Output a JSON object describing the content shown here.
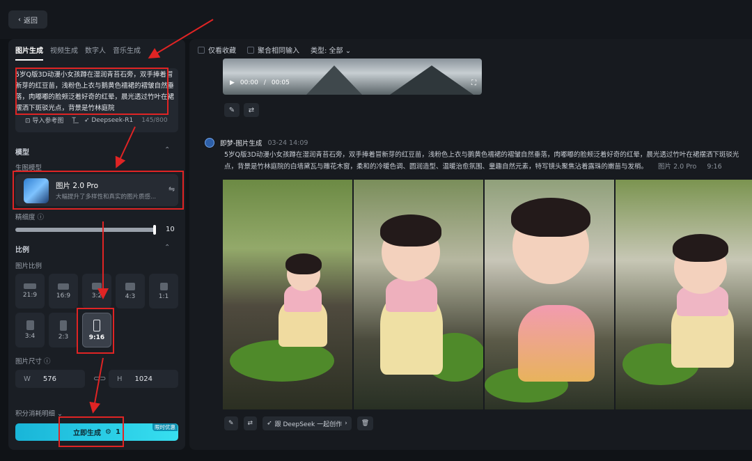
{
  "topbar": {
    "back_label": "返回"
  },
  "left": {
    "tabs": [
      {
        "label": "图片生成",
        "active": true
      },
      {
        "label": "视频生成",
        "active": false
      },
      {
        "label": "数字人",
        "active": false
      },
      {
        "label": "音乐生成",
        "active": false
      }
    ],
    "prompt": {
      "text": "5岁Q版3D动漫小女孩蹲在湿润青苔石旁，双手捧着冒新芽的红豆苗，浅粉色上衣与鹅黄色襦裙的褶皱自然垂落，肉嘟嘟的脸颊泛着好奇的红晕，晨光透过竹叶在裙摆洒下斑驳光点，背景是竹林庭院",
      "ref_image_label": "导入参考图",
      "model_label": "Deepseek-R1",
      "char_count": "145/800"
    },
    "model_section": {
      "title": "模型",
      "sub_label": "生图模型",
      "model_name": "图片 2.0 Pro",
      "model_desc": "大幅提升了多样性和真实的图片质感..."
    },
    "precision": {
      "label": "精细度",
      "value": "10",
      "fraction": 1.0
    },
    "ratio_section": {
      "title": "比例",
      "sub_label": "图片比例",
      "ratios": [
        {
          "label": "21:9",
          "active": false
        },
        {
          "label": "16:9",
          "active": false
        },
        {
          "label": "3:2",
          "active": false
        },
        {
          "label": "4:3",
          "active": false
        },
        {
          "label": "1:1",
          "active": false
        },
        {
          "label": "3:4",
          "active": false
        },
        {
          "label": "2:3",
          "active": false
        },
        {
          "label": "9:16",
          "active": true
        }
      ]
    },
    "size": {
      "label": "图片尺寸",
      "w_key": "W",
      "w_value": "576",
      "h_key": "H",
      "h_value": "1024"
    },
    "credits_label": "积分消耗明细",
    "generate": {
      "label": "立即生成",
      "cost": "1",
      "promo": "限时优惠"
    }
  },
  "main": {
    "filters": {
      "favorites": "仅看收藏",
      "aggregate": "聚合相同输入",
      "type": "类型: 全部"
    },
    "video": {
      "time": "00:00",
      "duration": "00:05"
    },
    "record": {
      "title": "即梦-图片生成",
      "time": "03-24  14:09",
      "prompt": "5岁Q版3D动漫小女孩蹲在湿润青苔石旁，双手捧着冒新芽的红豆苗，浅粉色上衣与鹅黄色襦裙的褶皱自然垂落，肉嘟嘟的脸颊泛着好奇的红晕，晨光透过竹叶在裙摆洒下斑驳光点，背景是竹林庭院的白墙黛瓦与雕花木窗，柔和的冷暖色调、圆润造型、温暖治愈氛围、童趣自然元素，特写镜头聚焦沾着露珠的嫩苗与发梢。",
      "model_tag": "图片 2.0 Pro",
      "ratio_tag": "9:16"
    },
    "actions": {
      "deepseek_label": "跟 DeepSeek 一起创作"
    }
  },
  "colors": {
    "accent": "#37dff0",
    "annotation": "#e02424"
  }
}
